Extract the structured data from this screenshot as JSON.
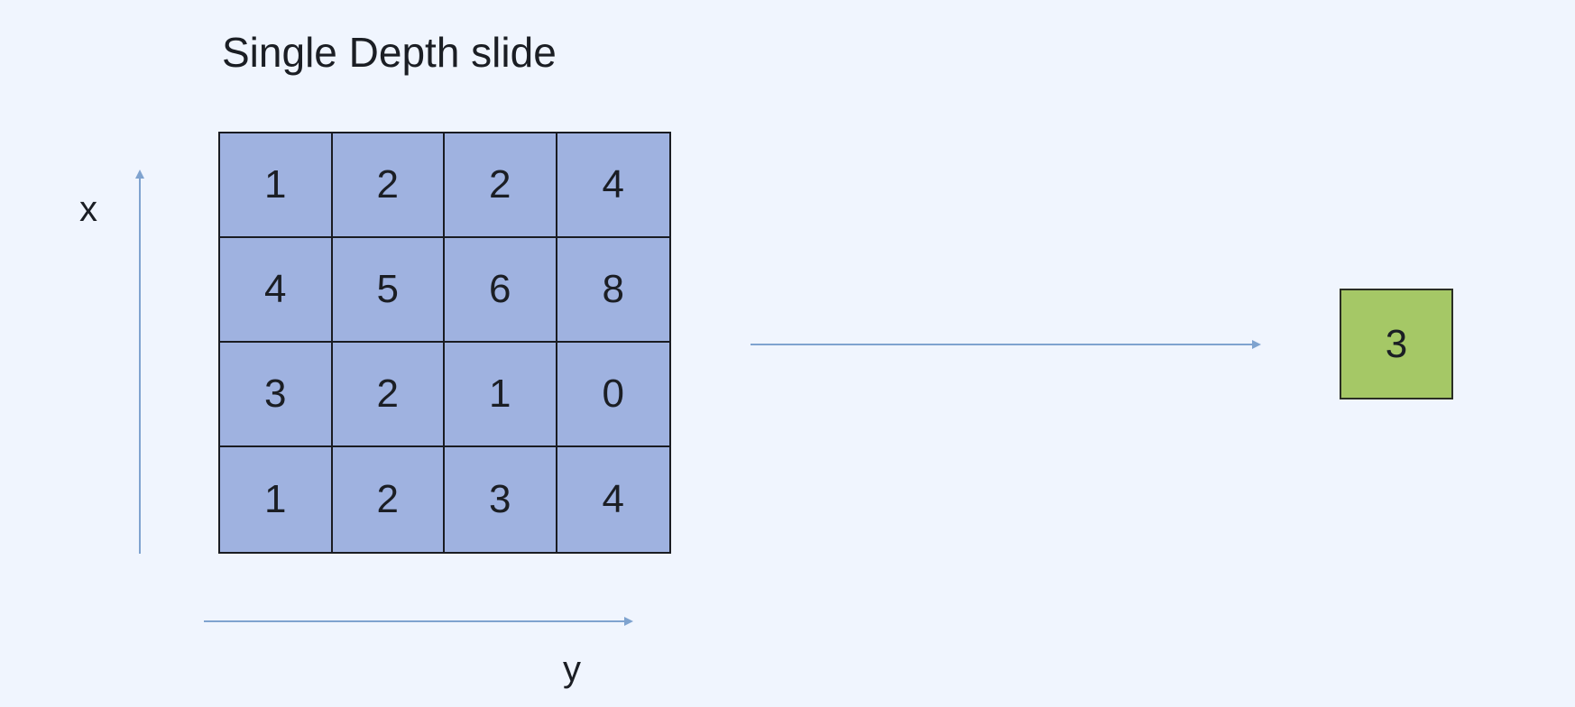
{
  "title": "Single Depth slide",
  "axes": {
    "x_label": "x",
    "y_label": "y"
  },
  "matrix": {
    "rows": [
      [
        "1",
        "2",
        "2",
        "4"
      ],
      [
        "4",
        "5",
        "6",
        "8"
      ],
      [
        "3",
        "2",
        "1",
        "0"
      ],
      [
        "1",
        "2",
        "3",
        "4"
      ]
    ]
  },
  "output": {
    "value": "3"
  },
  "colors": {
    "background": "#f0f5fe",
    "matrix_fill": "#9fb2e0",
    "output_fill": "#a5c866",
    "arrow": "#7fa3cf"
  }
}
